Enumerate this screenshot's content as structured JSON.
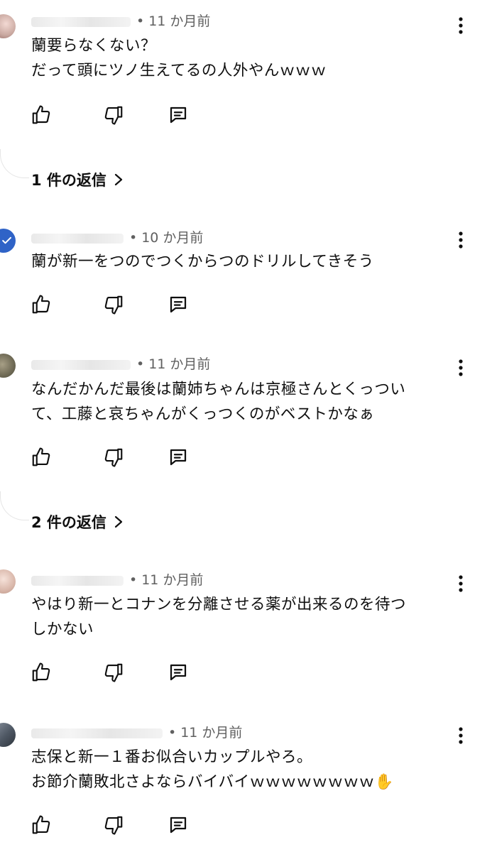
{
  "comments": [
    {
      "time": "11 か月前",
      "lines": [
        "蘭要らなくない？",
        "だって頭にツノ生えてるの人外やんｗｗｗ"
      ],
      "replies": "1 件の返信",
      "avatar_color": "#c9a8a0"
    },
    {
      "time": "10 か月前",
      "lines": [
        "蘭が新一をつのでつくからつのドリルしてきそう"
      ],
      "avatar_color": "#2f63c7"
    },
    {
      "time": "11 か月前",
      "lines": [
        "なんだかんだ最後は蘭姉ちゃんは京極さんとくっつい",
        "て、工藤と哀ちゃんがくっつくのがベストかなぁ"
      ],
      "replies": "2 件の返信",
      "avatar_color": "#7b7560"
    },
    {
      "time": "11 か月前",
      "lines": [
        "やはり新一とコナンを分離させる薬が出来るのを待つ",
        "しかない"
      ],
      "avatar_color": "#d9b7aa"
    },
    {
      "time": "11 か月前",
      "lines": [
        "志保と新一１番お似合いカップルやろ。",
        "お節介蘭敗北さよならバイバイｗｗｗｗｗｗｗｗ✋"
      ],
      "avatar_color": "#5b6470"
    }
  ],
  "icons": {
    "like": "thumbs-up-icon",
    "dislike": "thumbs-down-icon",
    "reply": "comment-icon",
    "more": "more-vert-icon",
    "replies": "chevron-right-icon"
  }
}
